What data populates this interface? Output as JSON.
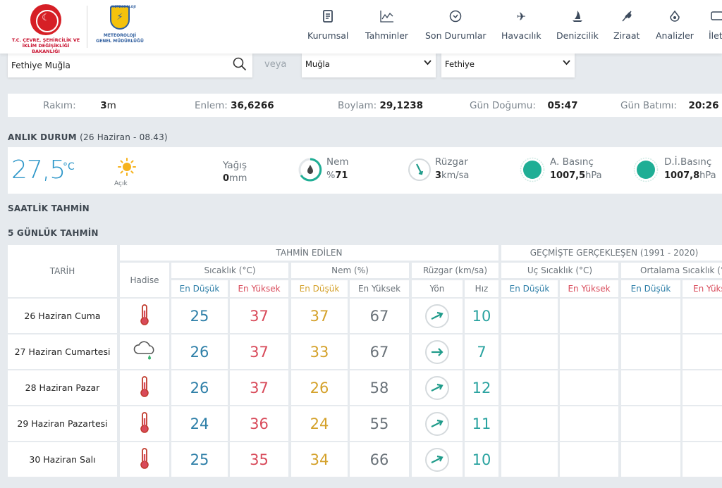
{
  "header": {
    "ministry_logo": {
      "line1": "T.C. ÇEVRE, ŞEHİRCİLİK VE",
      "line2": "İKLİM DEĞİŞİKLİĞİ BAKANLIĞI"
    },
    "mgm_logo": {
      "top": "METEOROLOJİ",
      "line1": "METEOROLOJİ",
      "line2": "GENEL MÜDÜRLÜĞÜ"
    },
    "nav": [
      {
        "label": "Kurumsal",
        "icon": "document-icon"
      },
      {
        "label": "Tahminler",
        "icon": "chart-icon"
      },
      {
        "label": "Son Durumlar",
        "icon": "clock-icon"
      },
      {
        "label": "Havacılık",
        "icon": "airplane-icon"
      },
      {
        "label": "Denizcilik",
        "icon": "sailboat-icon"
      },
      {
        "label": "Ziraat",
        "icon": "wheat-icon"
      },
      {
        "label": "Analizler",
        "icon": "analysis-icon"
      },
      {
        "label": "İleti",
        "icon": "message-icon"
      }
    ]
  },
  "search": {
    "value": "Fethiye Muğla",
    "or_label": "veya",
    "province": "Muğla",
    "district": "Fethiye"
  },
  "location": {
    "altitude_label": "Rakım:",
    "altitude_value": "3",
    "altitude_unit": "m",
    "latitude_label": "Enlem:",
    "latitude_value": "36,6266",
    "longitude_label": "Boylam:",
    "longitude_value": "29,1238",
    "sunrise_label": "Gün Doğumu:",
    "sunrise_value": "05:47",
    "sunset_label": "Gün Batımı:",
    "sunset_value": "20:26"
  },
  "current": {
    "title": "ANLIK DURUM",
    "subtitle": "(26 Haziran - 08.43)",
    "temperature": "27,5",
    "temperature_unit": "°C",
    "condition": "Açık",
    "precip_label": "Yağış",
    "precip_value": "0",
    "precip_unit": "mm",
    "humidity_label": "Nem",
    "humidity_prefix": "%",
    "humidity_value": "71",
    "wind_label": "Rüzgar",
    "wind_value": "3",
    "wind_unit": "km/sa",
    "pressure_label": "A. Basınç",
    "pressure_value": "1007,5",
    "pressure_unit": "hPa",
    "sea_pressure_label": "D.İ.Basınç",
    "sea_pressure_value": "1007,8",
    "sea_pressure_unit": "hPa"
  },
  "hourly_title": "SAATLİK TAHMİN",
  "forecast_title": "5 GÜNLÜK TAHMİN",
  "table": {
    "date_header": "TARİH",
    "forecast_group": "TAHMİN EDİLEN",
    "history_group": "GEÇMİŞTE GERÇEKLEŞEN (1991 - 2020)",
    "event_header": "Hadise",
    "temp_header": "Sıcaklık (°C)",
    "hum_header": "Nem (%)",
    "wind_header": "Rüzgar (km/sa)",
    "extreme_header": "Uç Sıcaklık (°C)",
    "avg_header": "Ortalama Sıcaklık (°C)",
    "low": "En Düşük",
    "high": "En Yüksek",
    "dir": "Yön",
    "speed": "Hız",
    "rows": [
      {
        "date": "26 Haziran Cuma",
        "icon": "thermometer-icon",
        "tmin": "25",
        "tmax": "37",
        "hmin": "37",
        "hmax": "67",
        "wind": "10"
      },
      {
        "date": "27 Haziran Cumartesi",
        "icon": "cloud-rain-icon",
        "tmin": "26",
        "tmax": "37",
        "hmin": "33",
        "hmax": "67",
        "wind": "7"
      },
      {
        "date": "28 Haziran Pazar",
        "icon": "thermometer-icon",
        "tmin": "26",
        "tmax": "37",
        "hmin": "26",
        "hmax": "58",
        "wind": "12"
      },
      {
        "date": "29 Haziran Pazartesi",
        "icon": "thermometer-icon",
        "tmin": "24",
        "tmax": "36",
        "hmin": "24",
        "hmax": "55",
        "wind": "11"
      },
      {
        "date": "30 Haziran Salı",
        "icon": "thermometer-icon",
        "tmin": "25",
        "tmax": "35",
        "hmin": "34",
        "hmax": "66",
        "wind": "10"
      }
    ]
  },
  "colors": {
    "accent": "#2e97c9",
    "low": "#2e7fa8",
    "high": "#d84a5a",
    "humidity_low": "#d4a12a",
    "wind": "#2aa3a0",
    "pressure": "#1fae95"
  }
}
